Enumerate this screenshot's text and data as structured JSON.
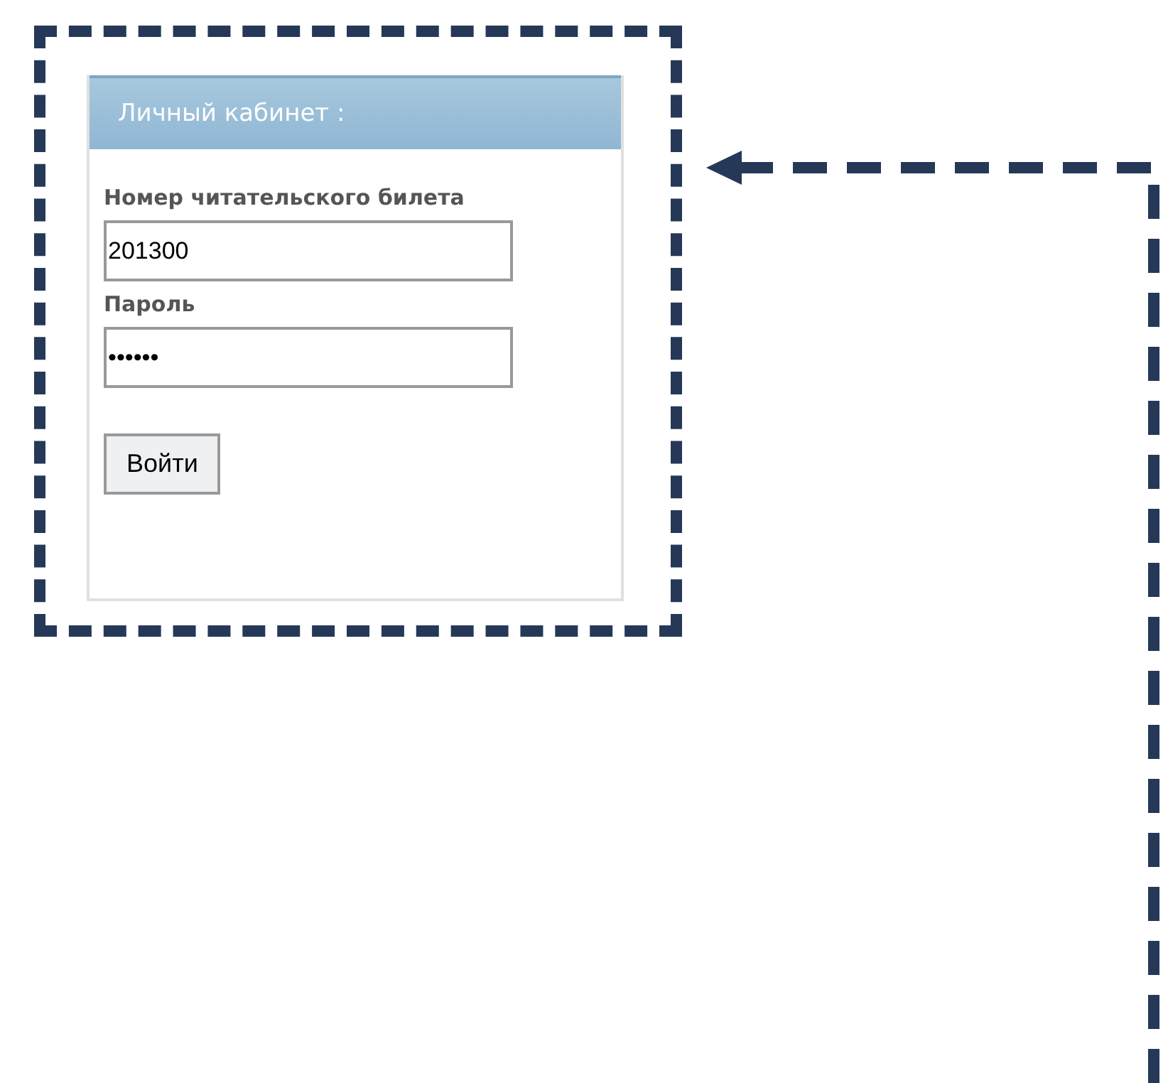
{
  "login_panel": {
    "title": "Личный кабинет :",
    "fields": [
      {
        "label": "Номер читательского билета",
        "value": "201300"
      },
      {
        "label": "Пароль",
        "value": "••••••"
      }
    ],
    "button": "Войти"
  }
}
